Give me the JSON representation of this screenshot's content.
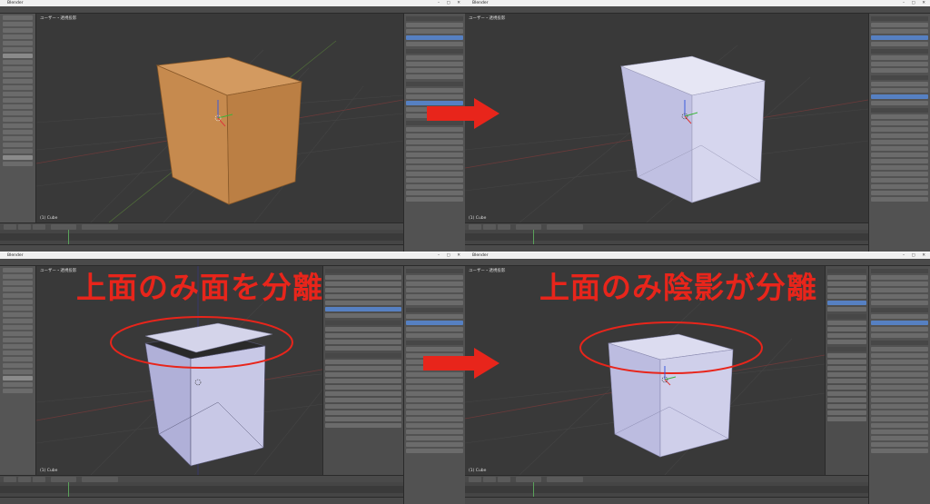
{
  "app": {
    "title": "Blender"
  },
  "captions": {
    "top_separated": "上面のみ面を分離",
    "top_shaded": "上面のみ陰影が分離"
  },
  "colors": {
    "caption": "#e8251b",
    "viewport_bg": "#393939",
    "panel_bg": "#525252",
    "cube_orange": "#c68a4e",
    "cube_lavender": "#c4c4e6",
    "arrow_red": "#e8251b"
  },
  "viewport": {
    "label": "ユーザー・透視投影",
    "object_name": "(1) Cube"
  },
  "icons": [
    "arrow-right-icon",
    "window-controls-icon",
    "3d-cursor-icon",
    "transform-gizmo-icon"
  ]
}
